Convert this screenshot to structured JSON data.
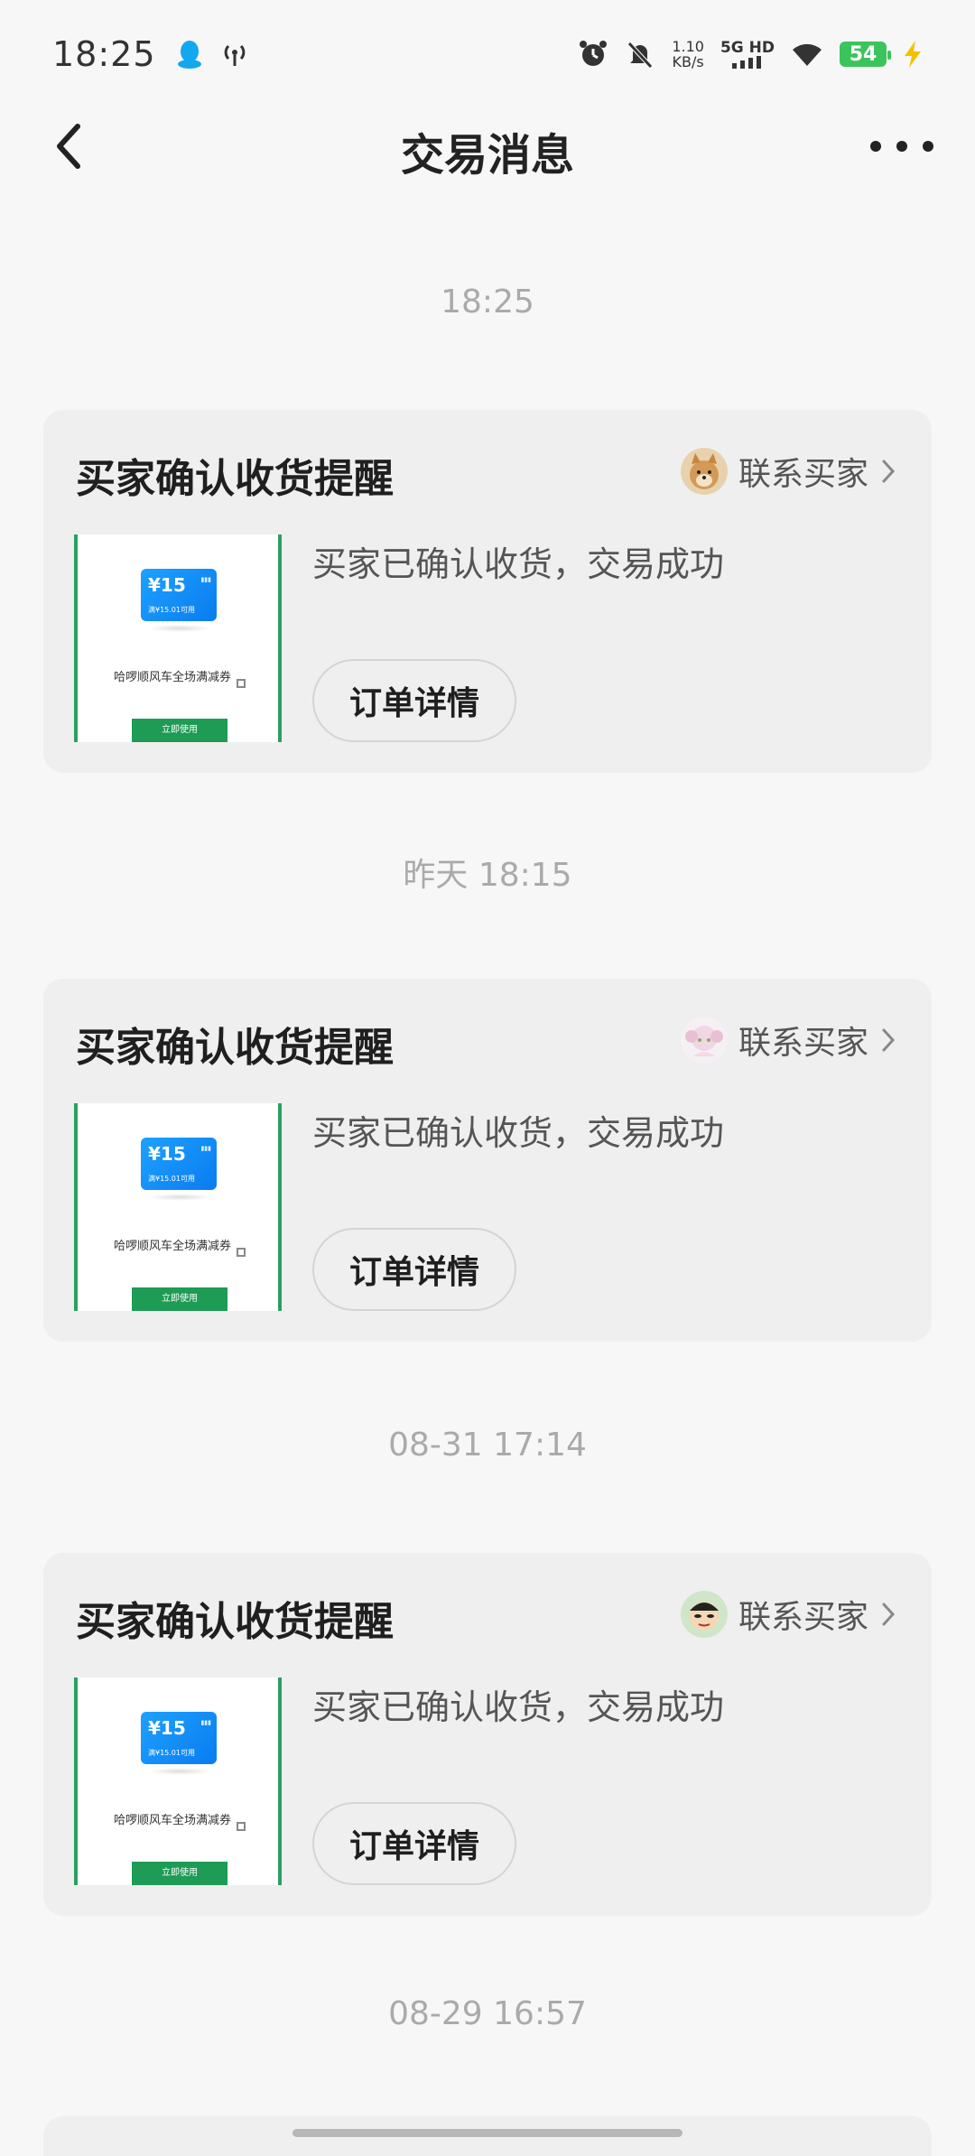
{
  "status_bar": {
    "time": "18:25",
    "speed_value": "1.10",
    "speed_unit": "KB/s",
    "network": "5G HD",
    "battery": "54",
    "icons": [
      "qq-notification-icon",
      "hotspot-icon",
      "alarm-icon",
      "mute-icon",
      "signal-icon",
      "wifi-icon",
      "battery-icon",
      "charging-icon"
    ]
  },
  "nav": {
    "title": "交易消息"
  },
  "messages": [
    {
      "timestamp": "18:25",
      "title": "买家确认收货提醒",
      "contact_label": "联系买家",
      "avatar": "shiba-dog-avatar",
      "body": "买家已确认收货，交易成功",
      "order_button": "订单详情",
      "thumb": {
        "price": "¥15",
        "condition": "满¥15.01可用",
        "desc": "哈啰顺风车全场满减券",
        "btn": "立即使用"
      }
    },
    {
      "timestamp": "昨天 18:15",
      "title": "买家确认收货提醒",
      "contact_label": "联系买家",
      "avatar": "anime-girl-avatar",
      "body": "买家已确认收货，交易成功",
      "order_button": "订单详情",
      "thumb": {
        "price": "¥15",
        "condition": "满¥15.01可用",
        "desc": "哈啰顺风车全场满减券",
        "btn": "立即使用"
      }
    },
    {
      "timestamp": "08-31 17:14",
      "title": "买家确认收货提醒",
      "contact_label": "联系买家",
      "avatar": "cartoon-boy-avatar",
      "body": "买家已确认收货，交易成功",
      "order_button": "订单详情",
      "thumb": {
        "price": "¥15",
        "condition": "满¥15.01可用",
        "desc": "哈啰顺风车全场满减券",
        "btn": "立即使用"
      }
    }
  ],
  "next_timestamp": "08-29 16:57",
  "colors": {
    "background": "#f7f7f7",
    "card": "#efefef",
    "accent_green": "#2aa061",
    "coupon_blue": "#0a7cf0"
  }
}
